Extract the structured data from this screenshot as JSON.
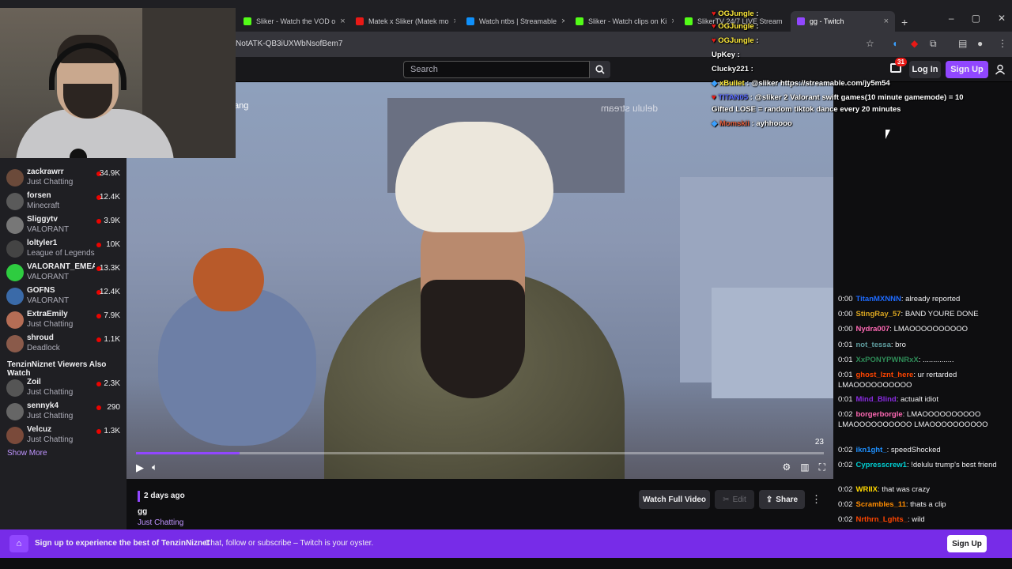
{
  "browser": {
    "tabs": [
      {
        "label": "Sliker - Watch the VOD o",
        "color": "#53fc18"
      },
      {
        "label": "Matek x Sliker (Matek mo",
        "color": "#e91916"
      },
      {
        "label": "Watch ntbs | Streamable",
        "color": "#0f90fa"
      },
      {
        "label": "Sliker - Watch clips on Ki",
        "color": "#53fc18"
      },
      {
        "label": "SlikerTV 24/7 LIVE Stream",
        "color": "#53fc18"
      },
      {
        "label": "gg - Twitch",
        "color": "#9147ff"
      }
    ],
    "url": "NotATK-QB3iUXWbNsofBem7"
  },
  "nav": {
    "search_placeholder": "Search",
    "notif_count": "31",
    "login": "Log In",
    "signup": "Sign Up"
  },
  "sidebar": {
    "channels": [
      {
        "name": "zackrawrr",
        "game": "Just Chatting",
        "viewers": "34.9K",
        "color": "#6b4a3a"
      },
      {
        "name": "forsen",
        "game": "Minecraft",
        "viewers": "12.4K",
        "color": "#5a5a5a"
      },
      {
        "name": "Sliggytv",
        "game": "VALORANT",
        "viewers": "3.9K",
        "color": "#777"
      },
      {
        "name": "loltyler1",
        "game": "League of Legends",
        "viewers": "10K",
        "color": "#444"
      },
      {
        "name": "VALORANT_EMEA",
        "game": "VALORANT",
        "viewers": "13.3K",
        "color": "#2ecc40"
      },
      {
        "name": "GOFNS",
        "game": "VALORANT",
        "viewers": "12.4K",
        "color": "#3a6aa8"
      },
      {
        "name": "ExtraEmily",
        "game": "Just Chatting",
        "viewers": "7.9K",
        "color": "#b56d55"
      },
      {
        "name": "shroud",
        "game": "Deadlock",
        "viewers": "1.1K",
        "color": "#8a5a4a"
      }
    ],
    "also_watch_heading": "TenzinNiznet Viewers Also Watch",
    "also_watch": [
      {
        "name": "Zoil",
        "game": "Just Chatting",
        "viewers": "2.3K",
        "color": "#555"
      },
      {
        "name": "sennyk4",
        "game": "Just Chatting",
        "viewers": "290",
        "color": "#666"
      },
      {
        "name": "Velcuz",
        "game": "Just Chatting",
        "viewers": "1.3K",
        "color": "#7a4a3a"
      }
    ],
    "show_more": "Show More"
  },
  "video": {
    "title_fragment": "ang",
    "watermark": "delulu stream",
    "progress": 0.15,
    "time_left": "23"
  },
  "clip": {
    "ago": "2 days ago",
    "title": "gg",
    "category": "Just Chatting",
    "watch_full": "Watch Full Video",
    "edit": "Edit",
    "share": "Share"
  },
  "overlay_chat": [
    {
      "user": "OGJungle",
      "text": "",
      "color": "#ffeb3b"
    },
    {
      "user": "OGJungle",
      "text": "",
      "color": "#ffeb3b"
    },
    {
      "user": "OGJungle",
      "text": "",
      "color": "#ffeb3b"
    },
    {
      "user": "UpKey",
      "text": "",
      "color": "#ffffff"
    },
    {
      "user": "Clucky221",
      "text": "",
      "color": "#ffffff"
    },
    {
      "user": "xBullet",
      "text": "@sliker https://streamable.com/jy5m54",
      "color": "#ffeb3b"
    },
    {
      "user": "TITAN05",
      "text": "@sliker 2 Valorant swift games(10 minute gamemode) = 10",
      "color": "#5b6bff"
    },
    {
      "user": "",
      "text": "Gifted LOSE = random tiktok dance every 20 minutes",
      "color": "#ffffff"
    },
    {
      "user": "Momskii",
      "text": "ayhhoooo",
      "color": "#e05d3c"
    }
  ],
  "side_chat": [
    {
      "time": "0:00",
      "user": "TitanMXNNN",
      "text": "already reported",
      "color": "#1e6bff"
    },
    {
      "time": "0:00",
      "user": "StingRay_57",
      "text": "BAND YOURE DONE",
      "color": "#daa520"
    },
    {
      "time": "0:00",
      "user": "Nydra007",
      "text": "LMAOOOOOOOOOO",
      "color": "#ff69b4"
    },
    {
      "time": "0:01",
      "user": "not_tessa",
      "text": "bro",
      "color": "#5f9ea0"
    },
    {
      "time": "0:01",
      "user": "XxPONYPWNRxX",
      "text": "...............",
      "color": "#2e8b57"
    },
    {
      "time": "0:01",
      "user": "ghost_lznt_here",
      "text": "ur rertarded LMAOOOOOOOOOO",
      "color": "#ff4500"
    },
    {
      "time": "0:01",
      "user": "Mind_Blind",
      "text": "actualt idiot",
      "color": "#8a2be2"
    },
    {
      "time": "0:02",
      "user": "borgerborgle",
      "text": "LMAOOOOOOOOOO LMAOOOOOOOOOO LMAOOOOOOOOOO",
      "color": "#ff69b4"
    },
    {
      "time": "0:02",
      "user": "ikn1ght_",
      "text": "speedShocked",
      "color": "#1e90ff"
    },
    {
      "time": "0:02",
      "user": "Cypresscrew1",
      "text": "!delulu trump's best friend",
      "color": "#00ced1"
    },
    {
      "time": "0:02",
      "user": "WRIIX",
      "text": "that was crazy",
      "color": "#ffd700"
    },
    {
      "time": "0:02",
      "user": "Scrambles_11",
      "text": "thats a clip",
      "color": "#ff8c00"
    },
    {
      "time": "0:02",
      "user": "Nrthrn_Lghts_",
      "text": "wild",
      "color": "#ff4500"
    }
  ],
  "banner": {
    "headline": "Sign up to experience the best of TenzinNiznet",
    "sub": "Chat, follow or subscribe – Twitch is your oyster.",
    "button": "Sign Up"
  },
  "colors": {
    "accent": "#9147ff",
    "banner": "#772ce8"
  }
}
